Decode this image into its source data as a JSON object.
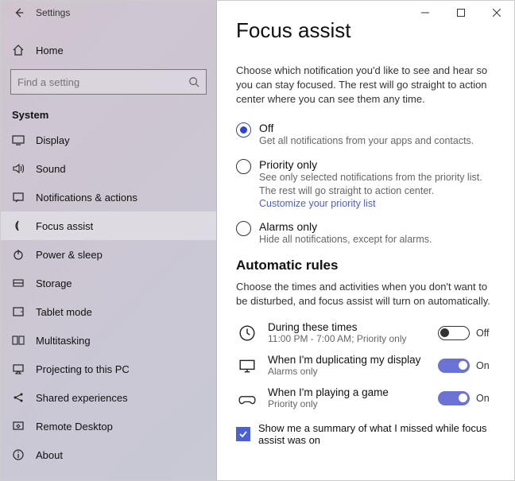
{
  "window": {
    "title": "Settings"
  },
  "sidebar": {
    "home": "Home",
    "search_placeholder": "Find a setting",
    "section": "System",
    "items": [
      {
        "label": "Display"
      },
      {
        "label": "Sound"
      },
      {
        "label": "Notifications & actions"
      },
      {
        "label": "Focus assist"
      },
      {
        "label": "Power & sleep"
      },
      {
        "label": "Storage"
      },
      {
        "label": "Tablet mode"
      },
      {
        "label": "Multitasking"
      },
      {
        "label": "Projecting to this PC"
      },
      {
        "label": "Shared experiences"
      },
      {
        "label": "Remote Desktop"
      },
      {
        "label": "About"
      }
    ]
  },
  "page": {
    "title": "Focus assist",
    "intro": "Choose which notification you'd like to see and hear so you can stay focused. The rest will go straight to action center where you can see them any time.",
    "radios": {
      "off": {
        "title": "Off",
        "sub": "Get all notifications from your apps and contacts."
      },
      "priority": {
        "title": "Priority only",
        "sub": "See only selected notifications from the priority list. The rest will go straight to action center.",
        "link": "Customize your priority list"
      },
      "alarms": {
        "title": "Alarms only",
        "sub": "Hide all notifications, except for alarms."
      }
    },
    "rules_header": "Automatic rules",
    "rules_desc": "Choose the times and activities when you don't want to be disturbed, and focus assist will turn on automatically.",
    "rules": {
      "times": {
        "title": "During these times",
        "sub": "11:00 PM - 7:00 AM; Priority only",
        "state": "Off"
      },
      "display": {
        "title": "When I'm duplicating my display",
        "sub": "Alarms only",
        "state": "On"
      },
      "game": {
        "title": "When I'm playing a game",
        "sub": "Priority only",
        "state": "On"
      }
    },
    "summary_check": "Show me a summary of what I missed while focus assist was on"
  }
}
